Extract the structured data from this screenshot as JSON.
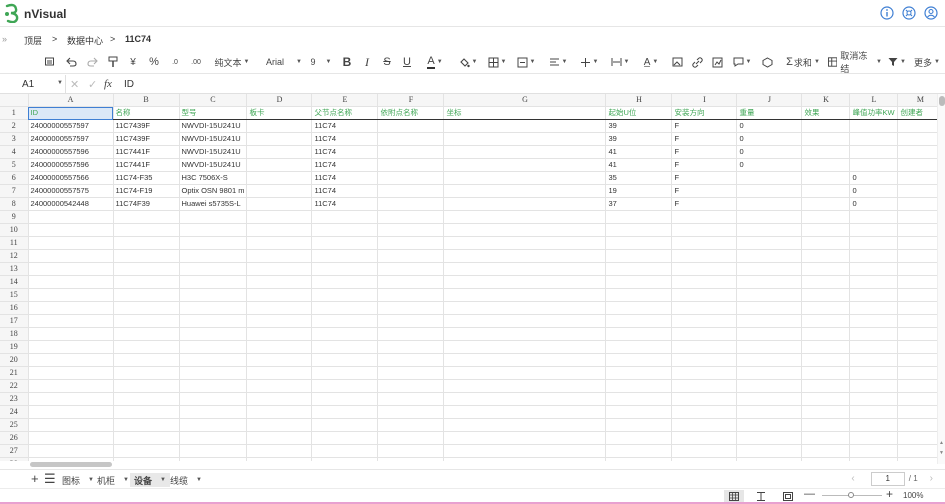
{
  "app": {
    "name": "nVisual"
  },
  "breadcrumb": {
    "root": "顶层",
    "level1": "数据中心",
    "current": "11C74",
    "sep": ">"
  },
  "toolbar": {
    "format_label": "纯文本",
    "font_family": "Arial",
    "font_size": "9",
    "currency": "¥",
    "percent": "%",
    "dec_inc": ".0",
    "dec_dec": ".00",
    "bold": "B",
    "italic": "I",
    "strike": "S",
    "underline": "U",
    "font_color": "A",
    "sum_label": "求和",
    "freeze_label": "取消冻结",
    "more_label": "更多"
  },
  "formula": {
    "cell_ref": "A1",
    "content": "ID",
    "fx": "fx"
  },
  "columns": [
    "A",
    "B",
    "C",
    "D",
    "E",
    "F",
    "G",
    "H",
    "I",
    "J",
    "K",
    "L",
    "M"
  ],
  "rows": [
    [
      "ID",
      "名称",
      "型号",
      "板卡",
      "父节点名称",
      "依附点名称",
      "坐标",
      "起始U位",
      "安装方向",
      "重量",
      "效果",
      "峰值功率KW",
      "创建者"
    ],
    [
      "24000000557597",
      "11C7439F",
      "NWVDI-15U241U",
      "",
      "11C74",
      "",
      "",
      "39",
      "F",
      "0",
      "",
      "",
      ""
    ],
    [
      "24000000557597",
      "11C7439F",
      "NWVDI-15U241U",
      "",
      "11C74",
      "",
      "",
      "39",
      "F",
      "0",
      "",
      "",
      ""
    ],
    [
      "24000000557596",
      "11C7441F",
      "NWVDI-15U241U",
      "",
      "11C74",
      "",
      "",
      "41",
      "F",
      "0",
      "",
      "",
      ""
    ],
    [
      "24000000557596",
      "11C7441F",
      "NWVDI-15U241U",
      "",
      "11C74",
      "",
      "",
      "41",
      "F",
      "0",
      "",
      "",
      ""
    ],
    [
      "24000000557566",
      "11C74-F35",
      "H3C 7506X-S",
      "",
      "11C74",
      "",
      "",
      "35",
      "F",
      "",
      "",
      "0",
      ""
    ],
    [
      "24000000557575",
      "11C74-F19",
      "Optix OSN 9801 m",
      "",
      "11C74",
      "",
      "",
      "19",
      "F",
      "",
      "",
      "0",
      ""
    ],
    [
      "24000000542448",
      "11C74F39",
      "Huawei s5735S-L",
      "",
      "11C74",
      "",
      "",
      "37",
      "F",
      "",
      "",
      "0",
      ""
    ]
  ],
  "row_count": 28,
  "sheets": [
    {
      "label": "图标"
    },
    {
      "label": "机柜"
    },
    {
      "label": "设备"
    },
    {
      "label": "线缆"
    }
  ],
  "pager": {
    "current": "1",
    "total": "/ 1"
  },
  "zoom": "100%",
  "colors": {
    "accent_green": "#3fa655",
    "selection_blue": "#3f7fd3",
    "header_blue": "#3f7fd3"
  }
}
